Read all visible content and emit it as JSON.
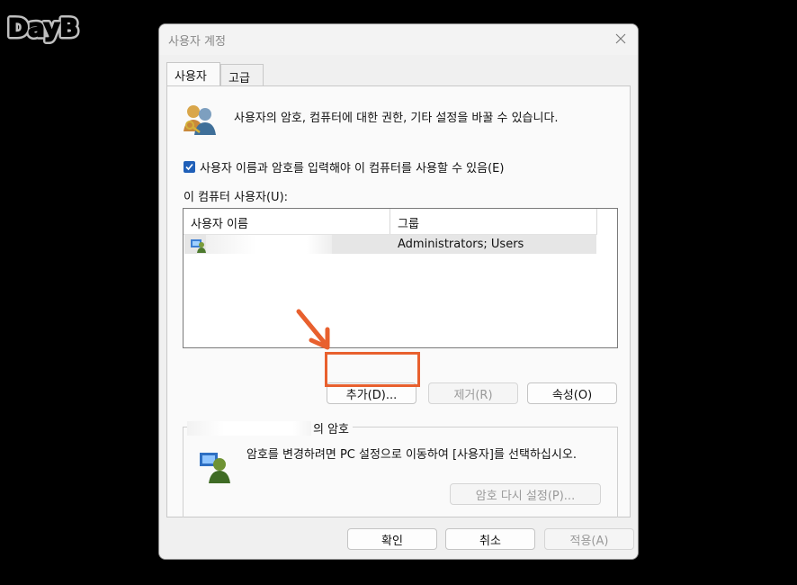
{
  "logo": {
    "text": "DayB"
  },
  "window": {
    "title": "사용자 계정",
    "close_icon": "close-icon"
  },
  "tabs": [
    {
      "label": "사용자",
      "active": true
    },
    {
      "label": "고급",
      "active": false
    }
  ],
  "intro": {
    "text": "사용자의 암호, 컴퓨터에 대한 권한, 기타 설정을 바꿀 수 있습니다.",
    "icon": "users-icon"
  },
  "require_login": {
    "label": "사용자 이름과 암호를 입력해야 이 컴퓨터를 사용할 수 있음(E)",
    "checked": true
  },
  "users_list": {
    "label": "이 컴퓨터 사용자(U):",
    "columns": [
      "사용자 이름",
      "그룹"
    ],
    "rows": [
      {
        "name": "",
        "group": "Administrators; Users",
        "icon": "user-icon"
      }
    ]
  },
  "list_buttons": {
    "add": "추가(D)...",
    "remove": "제거(R)",
    "properties": "속성(O)"
  },
  "password_section": {
    "legend_suffix": "의 암호",
    "text": "암호를 변경하려면 PC 설정으로 이동하여 [사용자]를 선택하십시오.",
    "reset_button": "암호 다시 설정(P)...",
    "icon": "user-key-icon"
  },
  "footer_buttons": {
    "ok": "확인",
    "cancel": "취소",
    "apply": "적용(A)"
  },
  "annotation": {
    "color": "#e8602e"
  }
}
